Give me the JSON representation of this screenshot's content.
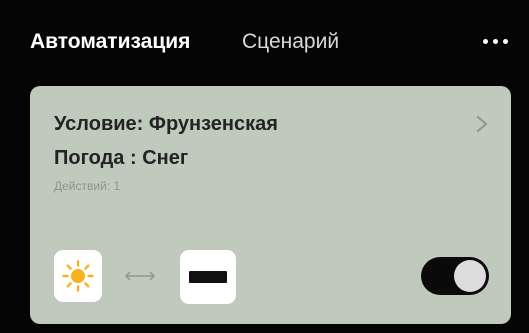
{
  "tabs": [
    {
      "label": "Автоматизация",
      "active": true
    },
    {
      "label": "Сценарий",
      "active": false
    }
  ],
  "menu_icon": "more-horizontal-icon",
  "card": {
    "condition": "Условие: Фрунзенская",
    "weather": "Погода : Снег",
    "actions": "Действий: 1",
    "trigger_icon": "sun-icon",
    "link_icon": "double-arrow-icon",
    "device_icon": "device-panel-icon",
    "nav_icon": "chevron-right-icon",
    "enabled": true
  },
  "colors": {
    "background": "#050505",
    "card": "#c0cabc",
    "sun": "#f7b21e",
    "toggle_on": "#0a0a0a"
  }
}
